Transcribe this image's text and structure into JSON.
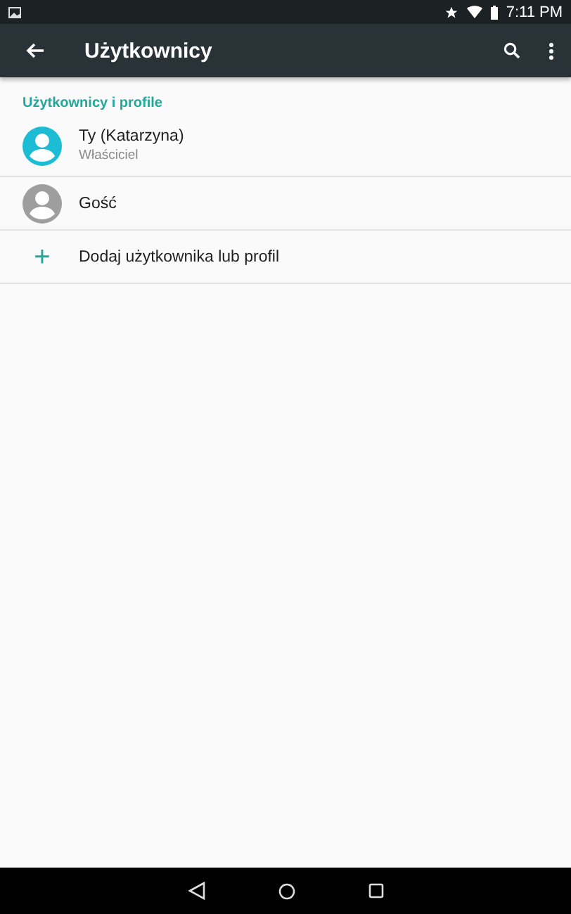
{
  "status_bar": {
    "time": "7:11 PM"
  },
  "toolbar": {
    "title": "Użytkownicy"
  },
  "section": {
    "title": "Użytkownicy i profile"
  },
  "items": [
    {
      "kind": "user",
      "name": "Ty (Katarzyna)",
      "subtitle": "Właściciel",
      "color": "#1cbcd4"
    },
    {
      "kind": "user",
      "name": "Gość",
      "color": "#9e9e9e"
    },
    {
      "kind": "add",
      "icon": "+",
      "name": "Dodaj użytkownika lub profil"
    }
  ]
}
